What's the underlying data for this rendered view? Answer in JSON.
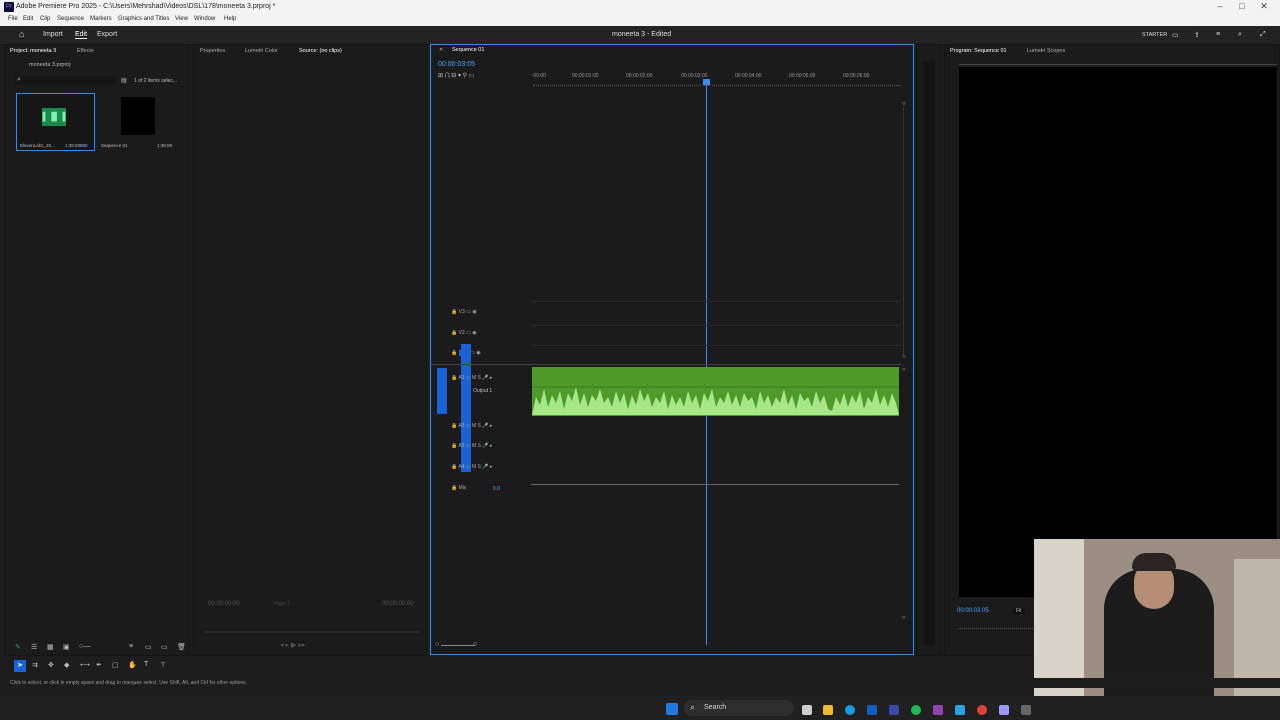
{
  "titlebar": {
    "title": "Adobe Premiere Pro 2025 - C:\\Users\\Mehrshad\\Videos\\DSL\\178\\moneeta 3.prproj *",
    "app_icon": "Pr"
  },
  "menubar": {
    "items": [
      "File",
      "Edit",
      "Clip",
      "Sequence",
      "Markers",
      "Graphics and Titles",
      "View",
      "Window",
      "Help"
    ]
  },
  "header": {
    "home_label": "⌂",
    "import": "Import",
    "edit": "Edit",
    "export": "Export",
    "project_title": "moneeta 3 - Edited",
    "starter": "STARTER"
  },
  "project": {
    "tabs": [
      "Project: moneeta 3",
      "Effects"
    ],
    "bin": "moneeta 3.prproj",
    "items_selected": "1 of 2 items selec...",
    "clips": [
      {
        "name": "ElevenLabs_20...",
        "duration": "1:38:20960"
      },
      {
        "name": "Sequence 01",
        "duration": "1:38:09"
      }
    ]
  },
  "source": {
    "tabs": [
      "Properties",
      "Lumetri Color",
      "Source: (no clips)"
    ],
    "tc_left": "00:00:00:00",
    "page": "Page 1",
    "tc_right": "00:00:00:00"
  },
  "timeline": {
    "tab": "Sequence 01",
    "timecode": "00:00:03:05",
    "ruler": [
      ":00:00",
      "00:00:01:00",
      "00:00:02:00",
      "00:00:03:00",
      "00:00:04:00",
      "00:00:05:00",
      "00:00:06:00"
    ],
    "video_tracks": [
      "V3",
      "V2",
      "V1"
    ],
    "audio_tracks": [
      "A1",
      "A2",
      "A3",
      "A4"
    ],
    "mix_label": "Mix",
    "mix_value": "0.0",
    "output_label": "Output 1",
    "clip_color": "#4f9b2a"
  },
  "program": {
    "tabs": [
      "Program: Sequence 01",
      "Lumetri Scopes"
    ],
    "timecode": "00:00:03:05",
    "fit": "Fit"
  },
  "status": {
    "text": "Click to select, or click in empty space and drag to marquee select. Use Shift, Alt, and Ctrl for other options."
  },
  "taskbar": {
    "search": "Search"
  }
}
